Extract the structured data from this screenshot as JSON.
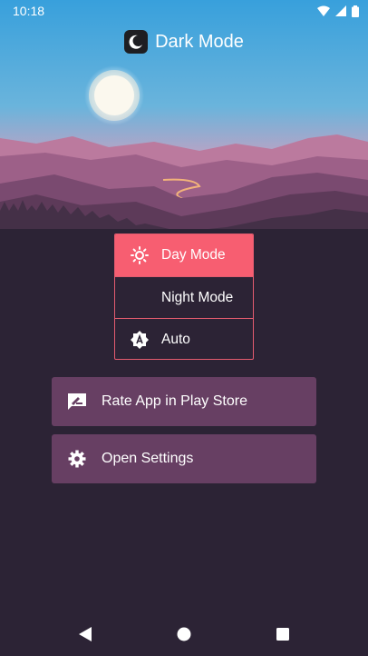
{
  "status_bar": {
    "time": "10:18",
    "icons": [
      "wifi-icon",
      "cellular-icon",
      "battery-icon"
    ]
  },
  "header": {
    "title": "Dark Mode",
    "logo_icon": "moon-icon"
  },
  "mode_options": [
    {
      "label": "Day Mode",
      "icon": "sun-icon",
      "selected": true
    },
    {
      "label": "Night Mode",
      "icon": "moon-icon",
      "selected": false
    },
    {
      "label": "Auto",
      "icon": "auto-brightness-icon",
      "selected": false
    }
  ],
  "actions": {
    "rate": {
      "label": "Rate App in Play Store",
      "icon": "rate-review-icon"
    },
    "settings": {
      "label": "Open Settings",
      "icon": "gear-icon"
    }
  },
  "nav_bar": {
    "items": [
      "back-icon",
      "home-icon",
      "recents-icon"
    ]
  },
  "colors": {
    "background": "#2c2335",
    "accent": "#f75e71",
    "accent_border": "#e45b6f",
    "button": "#673f63",
    "sky_top": "#38a0dc",
    "sky_bottom": "#d992ae"
  }
}
